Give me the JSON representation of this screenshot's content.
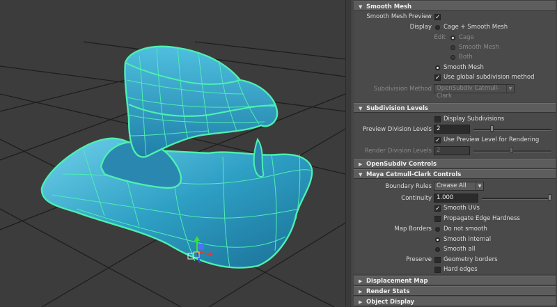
{
  "sections": {
    "smooth_mesh": "Smooth Mesh",
    "subdivision_levels": "Subdivision Levels",
    "opensubdiv_controls": "OpenSubdiv Controls",
    "maya_catmull_clark": "Maya Catmull-Clark Controls",
    "displacement_map": "Displacement Map",
    "render_stats": "Render Stats",
    "object_display": "Object Display"
  },
  "smooth_mesh": {
    "preview_label": "Smooth Mesh Preview",
    "preview_checked": true,
    "display_label": "Display",
    "display_option": "Cage + Smooth Mesh",
    "edit_label": "Edit",
    "edit_options": [
      "Cage",
      "Smooth Mesh",
      "Both"
    ],
    "smooth_mesh_option": "Smooth Mesh",
    "use_global_label": "Use global subdivision method",
    "use_global_checked": true,
    "subdiv_method_label": "Subdivision Method",
    "subdiv_method_value": "OpenSubdiv Catmull-Clark"
  },
  "subdivision": {
    "display_subdivisions_label": "Display Subdivisions",
    "display_subdivisions_checked": false,
    "preview_levels_label": "Preview Division Levels",
    "preview_levels_value": "2",
    "use_preview_label": "Use Preview Level for Rendering",
    "use_preview_checked": true,
    "render_levels_label": "Render Division Levels",
    "render_levels_value": "2"
  },
  "catmull": {
    "boundary_label": "Boundary Rules",
    "boundary_value": "Crease All",
    "continuity_label": "Continuity",
    "continuity_value": "1.000",
    "smooth_uvs_label": "Smooth UVs",
    "smooth_uvs_checked": true,
    "propagate_label": "Propagate Edge Hardness",
    "propagate_checked": false,
    "map_borders_label": "Map Borders",
    "map_border_options": [
      "Do not smooth",
      "Smooth internal",
      "Smooth all"
    ],
    "map_border_selected": "Smooth internal",
    "preserve_label": "Preserve",
    "geometry_borders_label": "Geometry borders",
    "geometry_borders_checked": false,
    "hard_edges_label": "Hard edges",
    "hard_edges_checked": false
  },
  "colors": {
    "mesh_fill": "#3fa9c9",
    "wireframe": "#4cf0b0",
    "viewport_bg": "#3c3c3c",
    "panel_bg": "#444444"
  }
}
